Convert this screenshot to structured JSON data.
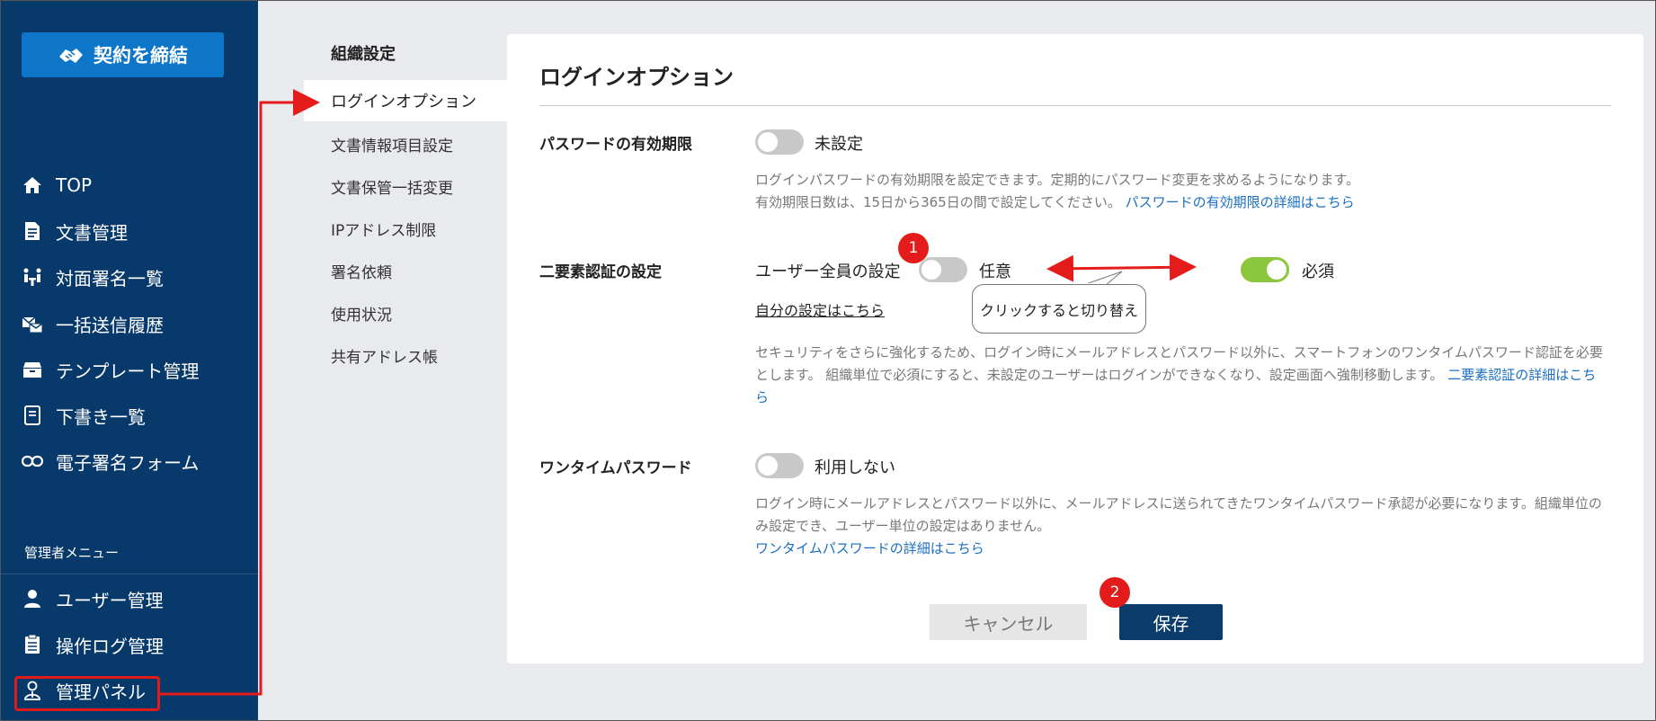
{
  "sidebar": {
    "contract_button": "契約を締結",
    "nav": [
      "TOP",
      "文書管理",
      "対面署名一覧",
      "一括送信履歴",
      "テンプレート管理",
      "下書き一覧",
      "電子署名フォーム"
    ],
    "admin_label": "管理者メニュー",
    "admin_nav": [
      "ユーザー管理",
      "操作ログ管理",
      "管理パネル"
    ],
    "icons": [
      "home-icon",
      "document-icon",
      "face-sign-icon",
      "bulk-send-icon",
      "template-icon",
      "draft-icon",
      "link-icon",
      "user-icon",
      "log-icon",
      "admin-panel-icon"
    ]
  },
  "subnav": {
    "title": "組織設定",
    "active": "ログインオプション",
    "items": [
      "文書情報項目設定",
      "文書保管一括変更",
      "IPアドレス制限",
      "署名依頼",
      "使用状況",
      "共有アドレス帳"
    ]
  },
  "card": {
    "title": "ログインオプション",
    "password_expiry": {
      "label": "パスワードの有効期限",
      "toggle_text": "未設定",
      "toggle_on": false,
      "desc_line1": "ログインパスワードの有効期限を設定できます。定期的にパスワード変更を求めるようになります。",
      "desc_line2": "有効期限日数は、15日から365日の間で設定してください。",
      "link": "パスワードの有効期限の詳細はこちら"
    },
    "two_factor": {
      "label": "二要素認証の設定",
      "all_users_label": "ユーザー全員の設定",
      "optional_text": "任意",
      "optional_on": false,
      "required_text": "必須",
      "required_on": true,
      "self_link": "自分の設定はこちら",
      "desc_line1": "セキュリティをさらに強化するため、ログイン時にメールアドレスとパスワード以外に、スマートフォンのワンタイムパスワード認証を必要",
      "desc_line2": "とします。 組織単位で必須にすると、未設定のユーザーはログインができなくなり、設定画面へ強制移動します。",
      "link_part1": "二要素認証の詳細はこち",
      "link_part2": "ら"
    },
    "otp": {
      "label": "ワンタイムパスワード",
      "toggle_text": "利用しない",
      "toggle_on": false,
      "desc_line1": "ログイン時にメールアドレスとパスワード以外に、メールアドレスに送られてきたワンタイムパスワード承認が必要になります。組織単位の",
      "desc_line2": "み設定でき、ユーザー単位の設定はありません。",
      "link": "ワンタイムパスワードの詳細はこちら"
    },
    "cancel_button": "キャンセル",
    "save_button": "保存"
  },
  "annotations": {
    "badge1": "1",
    "badge2": "2",
    "callout": "クリックすると切り替え",
    "accent_color": "#e41b1b"
  }
}
